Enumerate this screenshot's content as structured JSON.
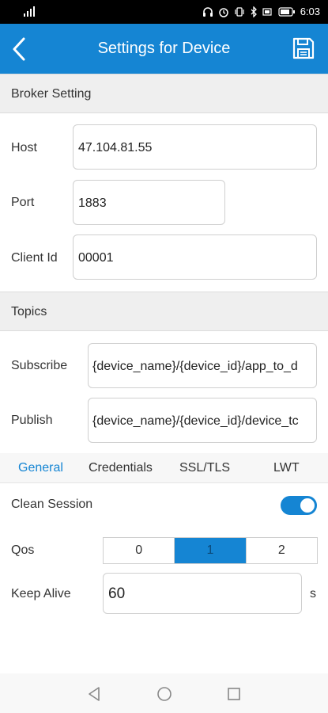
{
  "status_bar": {
    "time": "6:03",
    "icons": [
      "signal-icon",
      "wifi-icon",
      "headset-icon",
      "alarm-icon",
      "vibrate-icon",
      "bluetooth-icon",
      "battery-saver-icon",
      "battery-icon"
    ]
  },
  "app_bar": {
    "title": "Settings for Device",
    "back_icon": "chevron-left-icon",
    "save_icon": "save-disk-icon"
  },
  "broker": {
    "header": "Broker Setting",
    "host_label": "Host",
    "host_value": "47.104.81.55",
    "port_label": "Port",
    "port_value": "1883",
    "client_id_label": "Client Id",
    "client_id_value": "00001"
  },
  "topics": {
    "header": "Topics",
    "subscribe_label": "Subscribe",
    "subscribe_value": "{device_name}/{device_id}/app_to_d",
    "publish_label": "Publish",
    "publish_value": "{device_name}/{device_id}/device_tc"
  },
  "tabs": [
    {
      "label": "General",
      "active": true
    },
    {
      "label": "Credentials",
      "active": false
    },
    {
      "label": "SSL/TLS",
      "active": false
    },
    {
      "label": "LWT",
      "active": false
    }
  ],
  "general": {
    "clean_session_label": "Clean Session",
    "clean_session_on": true,
    "qos_label": "Qos",
    "qos_options": [
      "0",
      "1",
      "2"
    ],
    "qos_selected": "1",
    "keep_alive_label": "Keep Alive",
    "keep_alive_value": "60",
    "keep_alive_unit": "s"
  },
  "colors": {
    "accent": "#1585d3",
    "section_bg": "#efefef"
  },
  "nav_bar": {
    "icons": [
      "nav-back-icon",
      "nav-home-icon",
      "nav-recents-icon"
    ]
  }
}
